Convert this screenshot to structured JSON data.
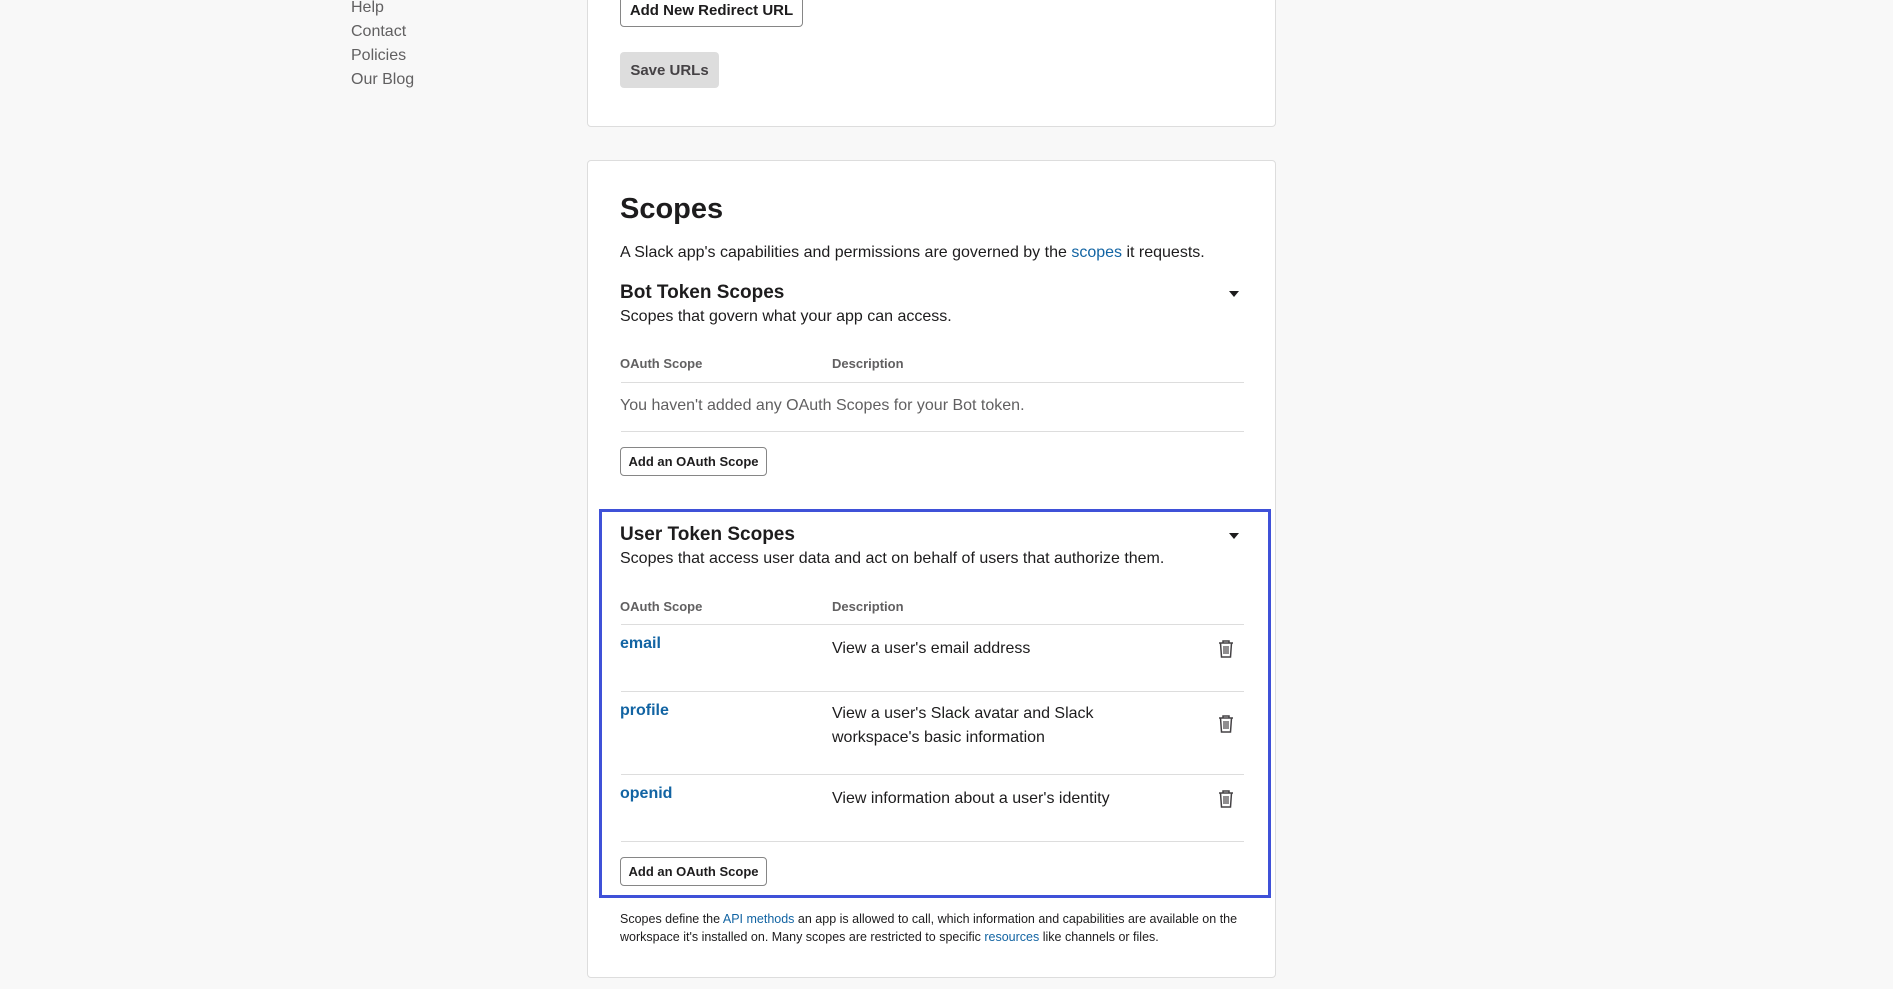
{
  "sidenav": {
    "items": [
      "Help",
      "Contact",
      "Policies",
      "Our Blog"
    ]
  },
  "redirect": {
    "add_button": "Add New Redirect URL",
    "save_button": "Save URLs"
  },
  "scopes": {
    "title": "Scopes",
    "intro_pre": "A Slack app's capabilities and permissions are governed by the ",
    "intro_link": "scopes",
    "intro_post": " it requests.",
    "bot": {
      "title": "Bot Token Scopes",
      "subtitle": "Scopes that govern what your app can access.",
      "col_scope": "OAuth Scope",
      "col_desc": "Description",
      "empty": "You haven't added any OAuth Scopes for your Bot token.",
      "add_button": "Add an OAuth Scope"
    },
    "user": {
      "title": "User Token Scopes",
      "subtitle": "Scopes that access user data and act on behalf of users that authorize them.",
      "col_scope": "OAuth Scope",
      "col_desc": "Description",
      "rows": [
        {
          "name": "email",
          "desc": "View a user's email address"
        },
        {
          "name": "profile",
          "desc": "View a user's Slack avatar and Slack workspace's basic information"
        },
        {
          "name": "openid",
          "desc": "View information about a user's identity"
        }
      ],
      "add_button": "Add an OAuth Scope"
    },
    "footer": {
      "p1": "Scopes define the ",
      "link1": "API methods",
      "p2": " an app is allowed to call, which information and capabilities are available on the workspace it's installed on. Many scopes are restricted to specific ",
      "link2": "resources",
      "p3": " like channels or files."
    }
  },
  "colors": {
    "link": "#1264a3",
    "highlight": "#3f51d8"
  }
}
